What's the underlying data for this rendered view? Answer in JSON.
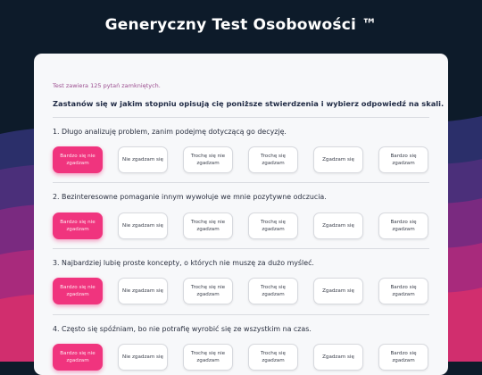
{
  "page": {
    "title": "Generyczny Test Osobowości ™"
  },
  "test": {
    "info": "Test zawiera 125 pytań zamkniętych.",
    "instruction": "Zastanów się w jakim stopniu opisują cię poniższe stwierdzenia i wybierz odpowiedź na skali."
  },
  "scale": [
    "Bardzo się nie zgadzam",
    "Nie zgadzam się",
    "Trochę się nie zgadzam",
    "Trochę się zgadzam",
    "Zgadzam się",
    "Bardzo się zgadzam"
  ],
  "questions": [
    {
      "text": "1. Długo analizuję problem, zanim podejmę dotyczącą go decyzję.",
      "selected_index": 0
    },
    {
      "text": "2. Bezinteresowne pomaganie innym wywołuje we mnie pozytywne odczucia.",
      "selected_index": 0
    },
    {
      "text": "3. Najbardziej lubię proste koncepty, o których nie muszę za dużo myśleć.",
      "selected_index": 0
    },
    {
      "text": "4. Często się spóźniam, bo nie potrafię wyrobić się ze wszystkim na czas.",
      "selected_index": 0
    }
  ],
  "colors": {
    "accent": "#f0347e",
    "background": "#0d1b2a",
    "card": "#f7f8fa"
  }
}
